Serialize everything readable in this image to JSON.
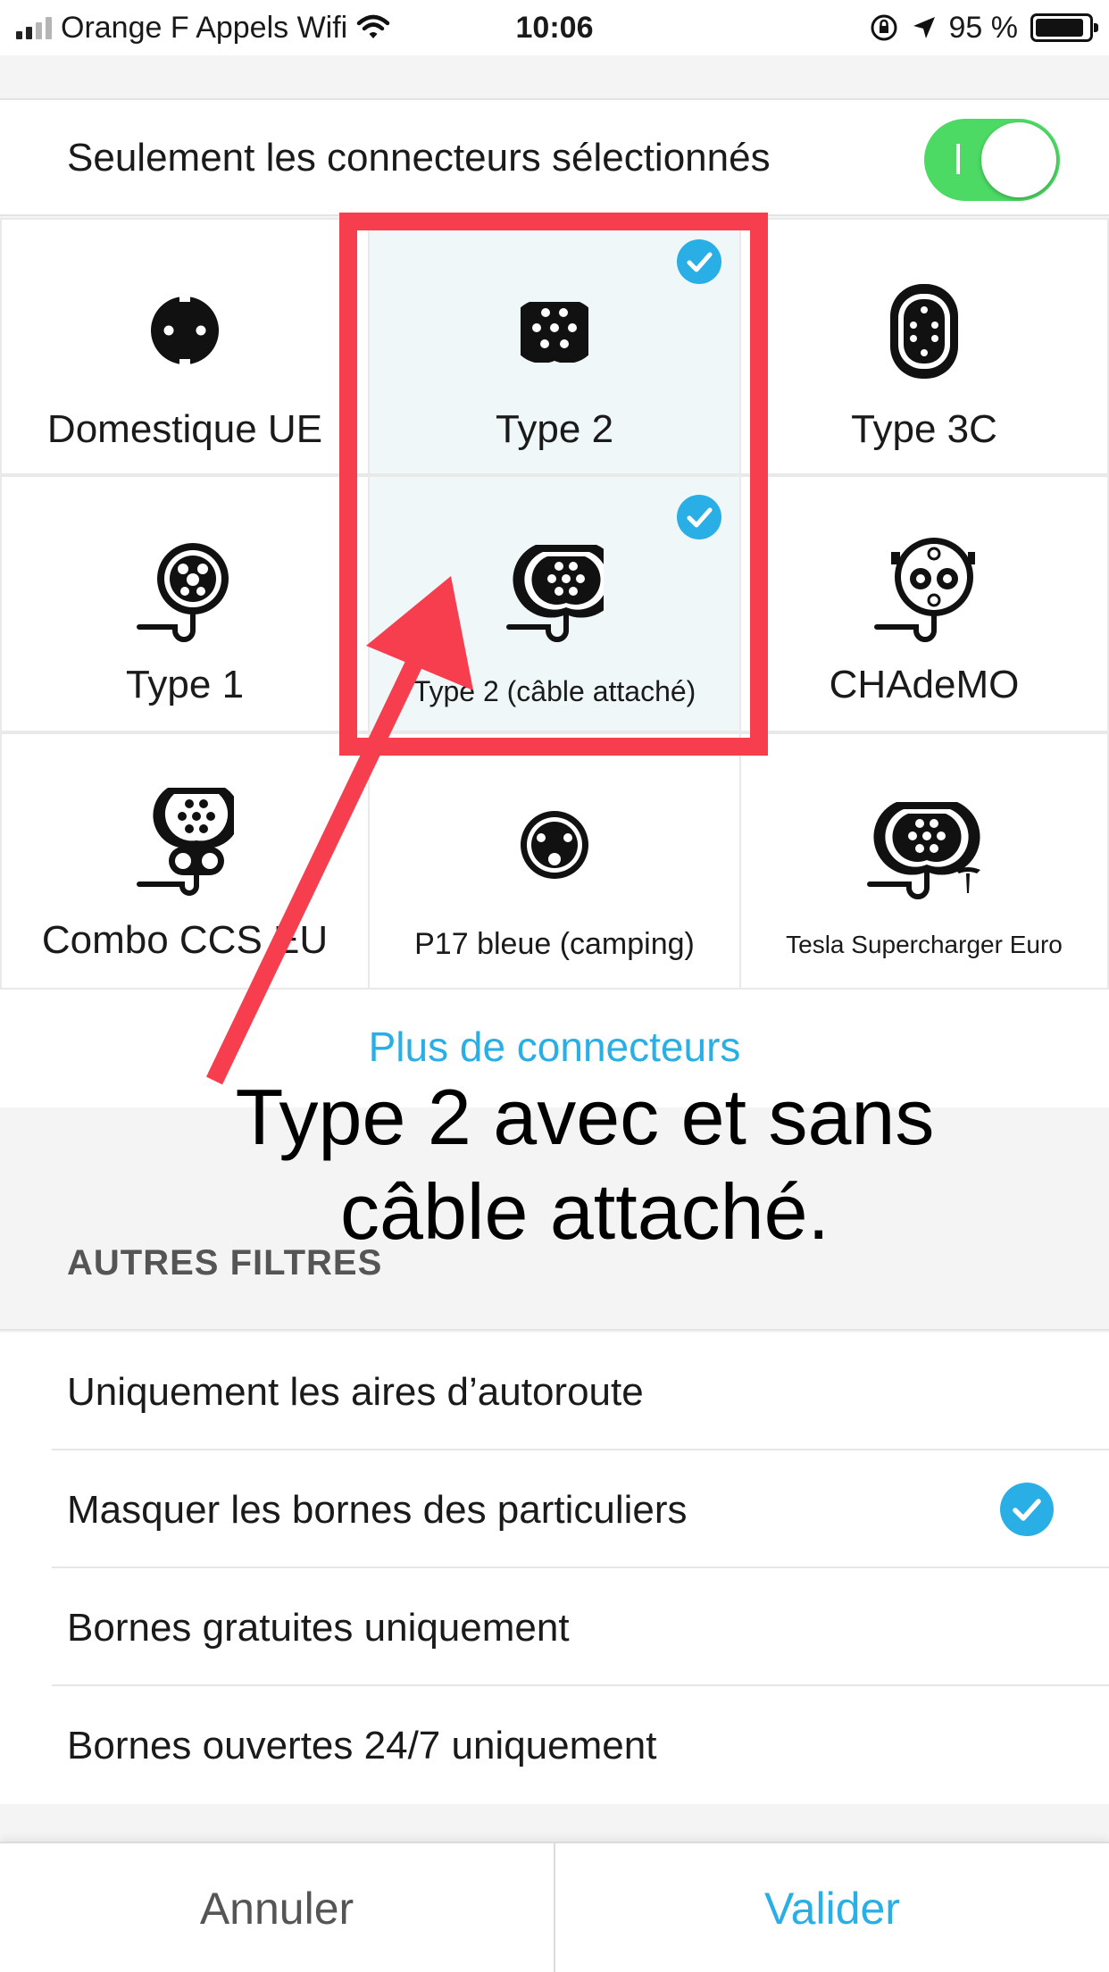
{
  "status_bar": {
    "carrier": "Orange F Appels Wifi",
    "time": "10:06",
    "battery": "95 %"
  },
  "toggle": {
    "label": "Seulement les connecteurs sélectionnés",
    "on": true
  },
  "connectors": [
    {
      "name": "Domestique UE",
      "icon": "schuko-plug-icon",
      "selected": false
    },
    {
      "name": "Type 2",
      "icon": "type2-socket-icon",
      "selected": true
    },
    {
      "name": "Type 3C",
      "icon": "type3c-socket-icon",
      "selected": false
    },
    {
      "name": "Type 1",
      "icon": "type1-cable-plug-icon",
      "selected": false
    },
    {
      "name": "Type 2 (câble attaché)",
      "icon": "type2-cable-plug-icon",
      "selected": true
    },
    {
      "name": "CHAdeMO",
      "icon": "chademo-plug-icon",
      "selected": false
    },
    {
      "name": "Combo CCS EU",
      "icon": "ccs-combo-plug-icon",
      "selected": false
    },
    {
      "name": "P17 bleue (camping)",
      "icon": "p17-socket-icon",
      "selected": false
    },
    {
      "name": "Tesla Supercharger Euro",
      "icon": "tesla-supercharger-icon",
      "selected": false
    }
  ],
  "more_connectors": "Plus de connecteurs",
  "filters": {
    "title": "AUTRES FILTRES",
    "items": [
      {
        "label": "Uniquement les aires d’autoroute",
        "checked": false
      },
      {
        "label": "Masquer les bornes des particuliers",
        "checked": true
      },
      {
        "label": "Bornes gratuites uniquement",
        "checked": false
      },
      {
        "label": "Bornes ouvertes 24/7 uniquement",
        "checked": false
      }
    ]
  },
  "actions": {
    "cancel": "Annuler",
    "confirm": "Valider"
  },
  "annotation": {
    "text_line1": "Type 2 avec et sans",
    "text_line2": "câble attaché.",
    "color": "#f73e4e"
  },
  "colors": {
    "accent": "#2aaee6",
    "toggle_on": "#4cd964",
    "selected_cell": "#eff7f9"
  }
}
